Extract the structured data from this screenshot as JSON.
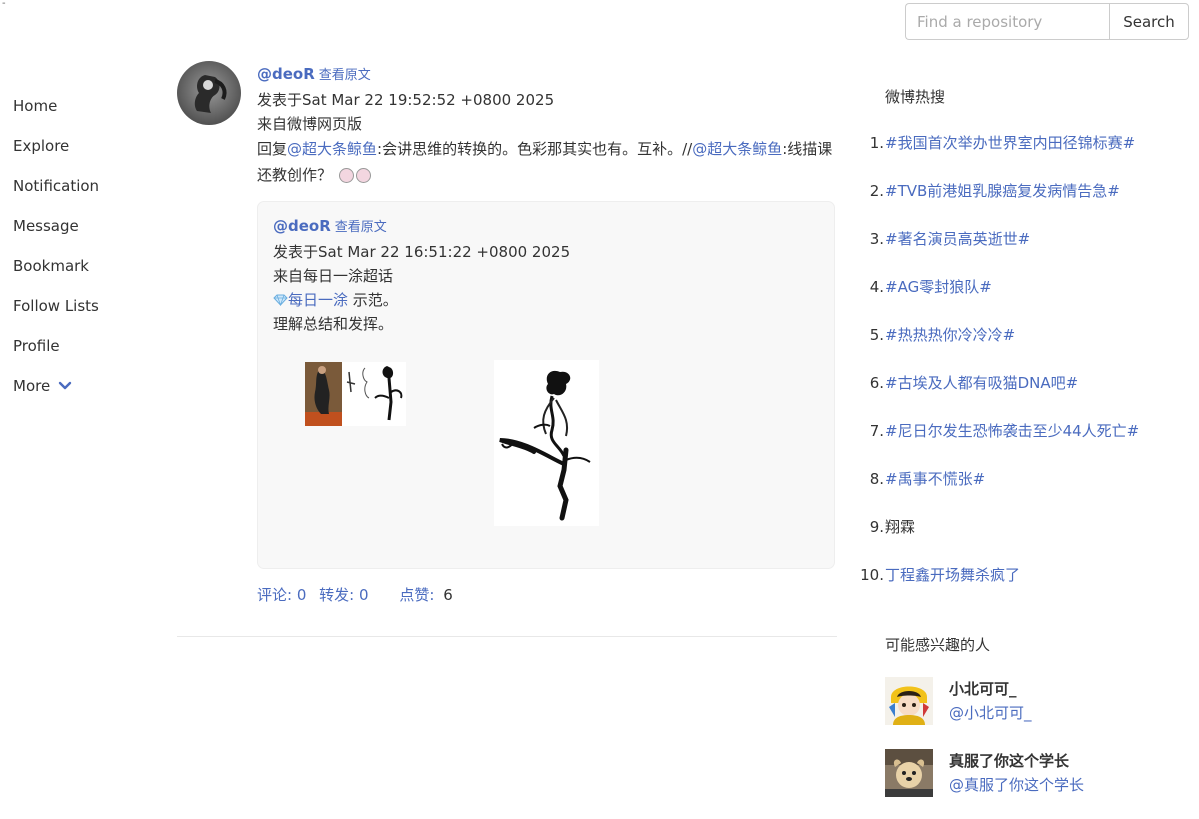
{
  "corner_mark": "-",
  "search": {
    "placeholder": "Find a repository",
    "button_label": "Search"
  },
  "nav": {
    "items": [
      {
        "label": "Home"
      },
      {
        "label": "Explore"
      },
      {
        "label": "Notification"
      },
      {
        "label": "Message"
      },
      {
        "label": "Bookmark"
      },
      {
        "label": "Follow Lists"
      },
      {
        "label": "Profile"
      },
      {
        "label": "More"
      }
    ]
  },
  "post": {
    "username": "@deoR",
    "view_original": "查看原文",
    "posted_at": "发表于Sat Mar 22 19:52:52 +0800 2025",
    "source": "来自微博网页版",
    "text_prefix": "回复",
    "mention_1": "@超大条鲸鱼",
    "text_middle": ":会讲思维的转换的。色彩那其实也有。互补。//",
    "mention_2": "@超大条鲸鱼",
    "text_suffix": ":线描课还教创作？",
    "quoted": {
      "username": "@deoR",
      "view_original": "查看原文",
      "posted_at": "发表于Sat Mar 22 16:51:22 +0800 2025",
      "source": "来自每日一涂超话",
      "topic_link": "每日一涂",
      "topic_suffix": " 示范。",
      "body": "理解总结和发挥。"
    },
    "stats": {
      "comments_label": "评论:",
      "comments": "0",
      "reposts_label": "转发:",
      "reposts": "0",
      "likes_label": "点赞:",
      "likes": "6"
    }
  },
  "sidebar": {
    "hot_title": "微博热搜",
    "hot_items": [
      {
        "num": "1.",
        "text": "#我国首次举办世界室内田径锦标赛#"
      },
      {
        "num": "2.",
        "text": "#TVB前港姐乳腺癌复发病情告急#"
      },
      {
        "num": "3.",
        "text": "#著名演员高英逝世#"
      },
      {
        "num": "4.",
        "text": "#AG零封狼队#"
      },
      {
        "num": "5.",
        "text": "#热热热你冷冷冷#"
      },
      {
        "num": "6.",
        "text": "#古埃及人都有吸猫DNA吧#"
      },
      {
        "num": "7.",
        "text": "#尼日尔发生恐怖袭击至少44人死亡#"
      },
      {
        "num": "8.",
        "text": "#禹事不慌张#"
      },
      {
        "num": "9.",
        "text": "翔霖"
      },
      {
        "num": "10.",
        "text": "丁程鑫开场舞杀疯了"
      }
    ],
    "people_title": "可能感兴趣的人",
    "people": [
      {
        "name": "小北可可_",
        "handle": "@小北可可_"
      },
      {
        "name": "真服了你这个学长",
        "handle": "@真服了你这个学长"
      }
    ]
  }
}
